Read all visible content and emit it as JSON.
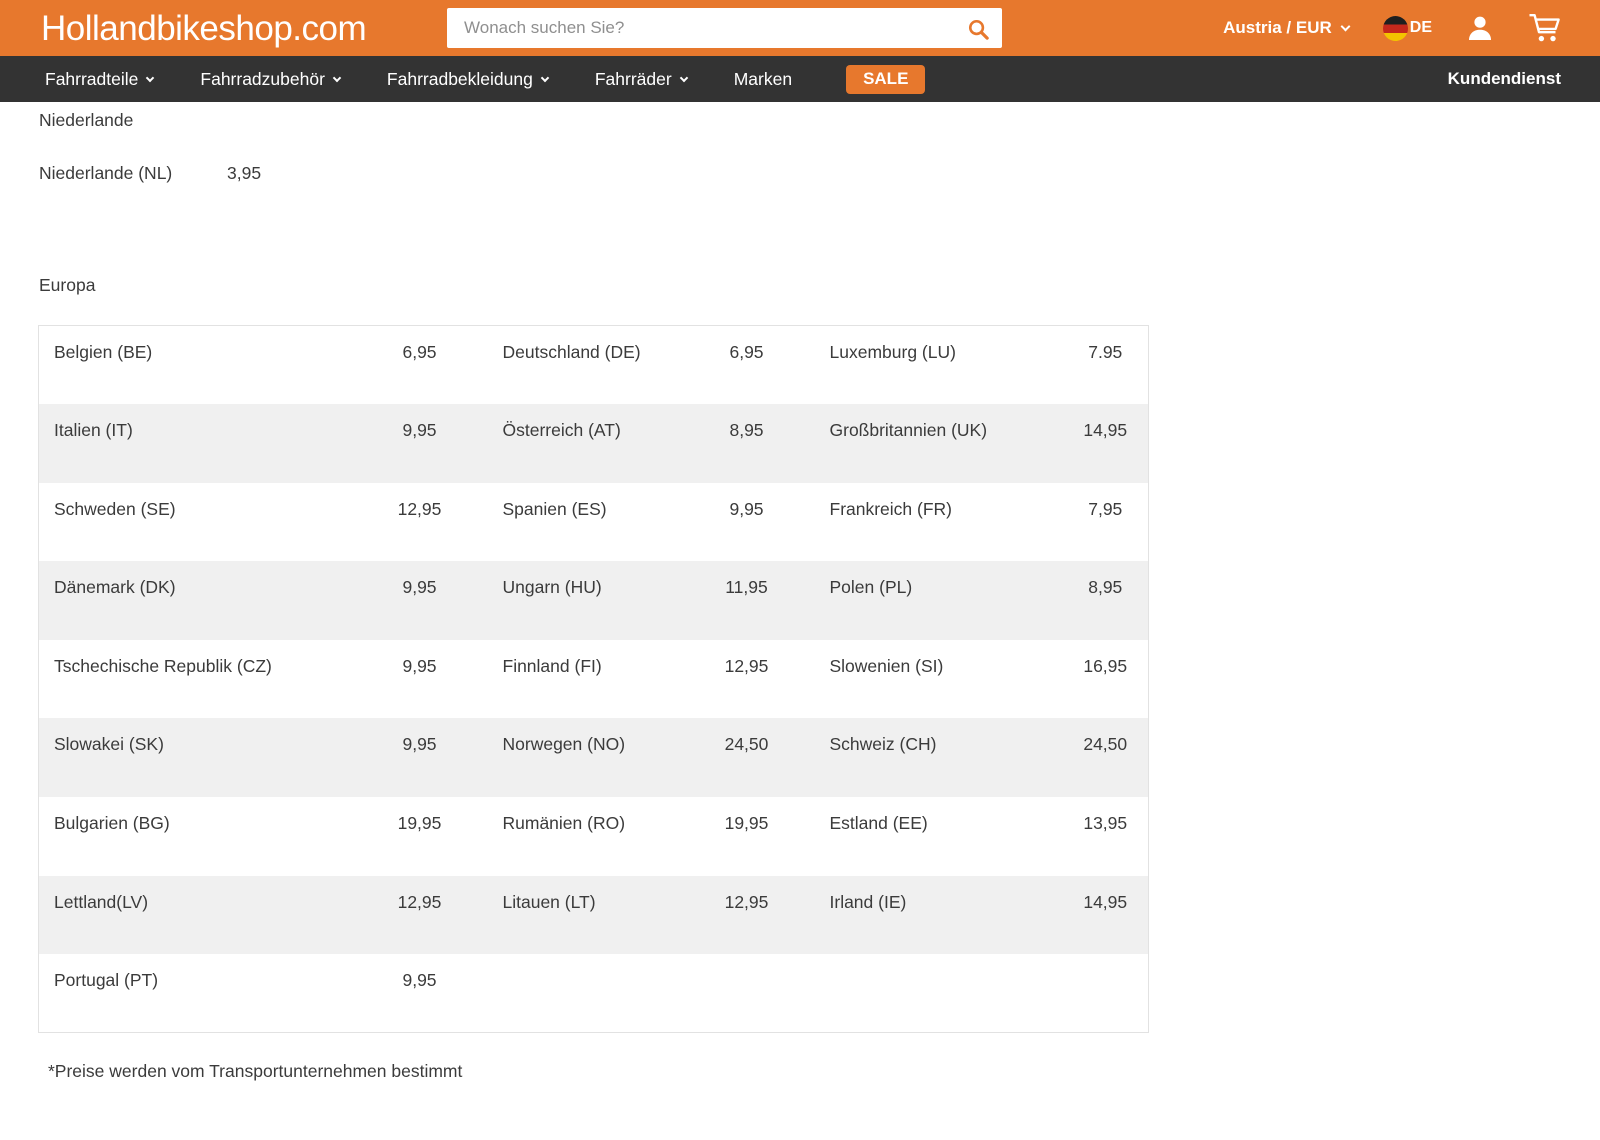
{
  "header": {
    "logo": "Hollandbikeshop.com",
    "search": {
      "placeholder": "Wonach suchen Sie?"
    },
    "locale_selector": "Austria / EUR",
    "language_code": "DE"
  },
  "nav": {
    "items": [
      {
        "label": "Fahrradteile",
        "dropdown": true
      },
      {
        "label": "Fahrradzubehör",
        "dropdown": true
      },
      {
        "label": "Fahrradbekleidung",
        "dropdown": true
      },
      {
        "label": "Fahrräder",
        "dropdown": true
      },
      {
        "label": "Marken",
        "dropdown": false
      }
    ],
    "sale": "SALE",
    "kundendienst": "Kundendienst"
  },
  "shipping": {
    "netherlands_title": "Niederlande",
    "netherlands_row": {
      "country": "Niederlande (NL)",
      "price": "3,95"
    },
    "europe_title": "Europa",
    "europe_rows": [
      [
        "Belgien (BE)",
        "6,95",
        "Deutschland (DE)",
        "6,95",
        "Luxemburg (LU)",
        "7.95"
      ],
      [
        "Italien (IT)",
        "9,95",
        "Österreich (AT)",
        "8,95",
        "Großbritannien (UK)",
        "14,95"
      ],
      [
        "Schweden (SE)",
        "12,95",
        "Spanien (ES)",
        "9,95",
        "Frankreich (FR)",
        "7,95"
      ],
      [
        "Dänemark (DK)",
        "9,95",
        "Ungarn (HU)",
        "11,95",
        "Polen (PL)",
        "8,95"
      ],
      [
        "Tschechische Republik  (CZ)",
        "9,95",
        "Finnland (FI)",
        "12,95",
        "Slowenien (SI)",
        "16,95"
      ],
      [
        "Slowakei (SK)",
        "9,95",
        "Norwegen (NO)",
        "24,50",
        "Schweiz (CH)",
        "24,50"
      ],
      [
        "Bulgarien (BG)",
        "19,95",
        "Rumänien (RO)",
        "19,95",
        "Estland (EE)",
        "13,95"
      ],
      [
        "Lettland(LV)",
        "12,95",
        "Litauen (LT)",
        "12,95",
        "Irland (IE)",
        "14,95"
      ],
      [
        "Portugal (PT)",
        "9,95",
        "",
        "",
        "",
        ""
      ]
    ],
    "footnote": "*Preise werden vom Transportunternehmen bestimmt"
  },
  "colors": {
    "accent_orange": "#E7782D",
    "nav_background": "#333333",
    "table_alt_row": "#F0F0F0",
    "table_border": "#E2E2E2",
    "text": "#3B3B3B",
    "flag_black": "#1F1F1F",
    "flag_red": "#C5281C",
    "flag_gold": "#F3C300"
  }
}
